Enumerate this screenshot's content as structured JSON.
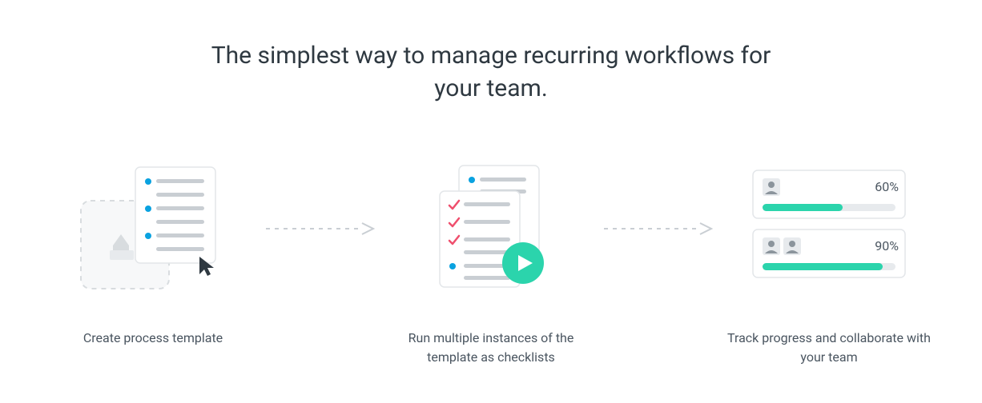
{
  "headline": "The simplest way to manage recurring workflows for your team.",
  "steps": [
    {
      "caption": "Create process template"
    },
    {
      "caption": "Run multiple instances of the template as checklists"
    },
    {
      "caption": "Track progress and collaborate with your team"
    }
  ],
  "progress": {
    "card1_percent": "60%",
    "card2_percent": "90%"
  },
  "colors": {
    "teal": "#2bd4ac",
    "blue": "#0aa2e0",
    "pink": "#ef4f6d",
    "grayLine": "#c9ced3",
    "grayFill": "#e7eaed",
    "text": "#4a5560",
    "border": "#e3e6e9"
  }
}
